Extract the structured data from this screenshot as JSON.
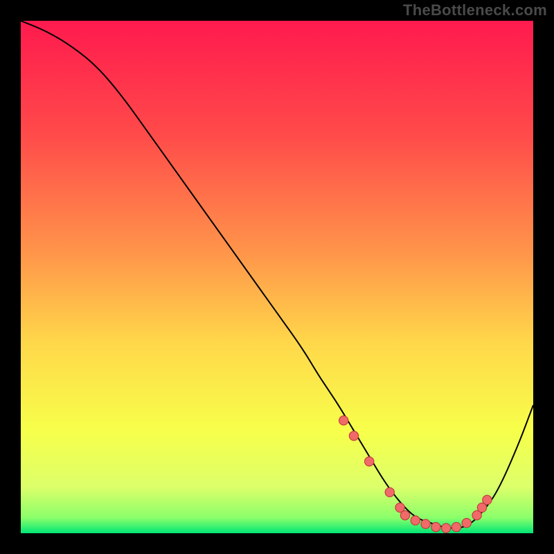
{
  "watermark": "TheBottleneck.com",
  "colors": {
    "background": "#000000",
    "gradient_stops": [
      {
        "pos": 0,
        "color": "#ff1a4e"
      },
      {
        "pos": 22,
        "color": "#ff4a4a"
      },
      {
        "pos": 45,
        "color": "#ff944a"
      },
      {
        "pos": 63,
        "color": "#ffd84a"
      },
      {
        "pos": 80,
        "color": "#f7ff4a"
      },
      {
        "pos": 91,
        "color": "#dcff6a"
      },
      {
        "pos": 97,
        "color": "#8aff6a"
      },
      {
        "pos": 100,
        "color": "#00e676"
      }
    ],
    "curve": "#000000",
    "marker_fill": "#f06a6a",
    "marker_stroke": "#c03a3a"
  },
  "chart_data": {
    "type": "line",
    "title": "",
    "xlabel": "",
    "ylabel": "",
    "xlim": [
      0,
      100
    ],
    "ylim": [
      0,
      100
    ],
    "grid": false,
    "legend": false,
    "series": [
      {
        "name": "bottleneck-curve",
        "x": [
          0,
          5,
          10,
          15,
          20,
          25,
          30,
          35,
          40,
          45,
          50,
          55,
          58,
          60,
          62,
          65,
          68,
          71,
          74,
          77,
          80,
          83,
          86,
          88,
          90,
          93,
          97,
          100
        ],
        "y": [
          100,
          98,
          95,
          91,
          85,
          78,
          71,
          64,
          57,
          50,
          43,
          36,
          31,
          28,
          25,
          20,
          15,
          10,
          6,
          3,
          2,
          1,
          1,
          2,
          4,
          8,
          17,
          25
        ]
      }
    ],
    "markers": [
      {
        "x": 63,
        "y": 22
      },
      {
        "x": 65,
        "y": 19
      },
      {
        "x": 68,
        "y": 14
      },
      {
        "x": 72,
        "y": 8
      },
      {
        "x": 74,
        "y": 5
      },
      {
        "x": 75,
        "y": 3.5
      },
      {
        "x": 77,
        "y": 2.5
      },
      {
        "x": 79,
        "y": 1.8
      },
      {
        "x": 81,
        "y": 1.2
      },
      {
        "x": 83,
        "y": 1
      },
      {
        "x": 85,
        "y": 1.2
      },
      {
        "x": 87,
        "y": 2
      },
      {
        "x": 89,
        "y": 3.5
      },
      {
        "x": 90,
        "y": 5
      },
      {
        "x": 91,
        "y": 6.5
      }
    ]
  }
}
